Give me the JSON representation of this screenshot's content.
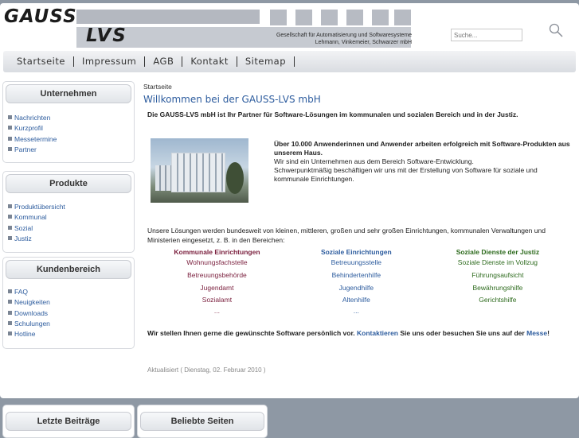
{
  "header": {
    "logo_top": "GAUSS",
    "logo_bottom": "LVS",
    "tagline_1": "Gesellschaft für Automatisierung und Softwaresysteme",
    "tagline_2": "Lehmann, Vinkemeier, Schwarzer mbH",
    "search_placeholder": "Suche..."
  },
  "nav": [
    "Startseite",
    "Impressum",
    "AGB",
    "Kontakt",
    "Sitemap"
  ],
  "sidebar": [
    {
      "title": "Unternehmen",
      "items": [
        "Nachrichten",
        "Kurzprofil",
        "Messetermine",
        "Partner"
      ]
    },
    {
      "title": "Produkte",
      "items": [
        "Produktübersicht",
        "Kommunal",
        "Sozial",
        "Justiz"
      ]
    },
    {
      "title": "Kundenbereich",
      "items": [
        "FAQ",
        "Neuigkeiten",
        "Downloads",
        "Schulungen",
        "Hotline"
      ]
    }
  ],
  "main": {
    "breadcrumb": "Startseite",
    "title": "Willkommen bei der GAUSS-LVS mbH",
    "intro": "Die GAUSS-LVS mbH ist Ihr Partner für Software-Lösungen im kommunalen und sozialen Bereich und in der Justiz.",
    "highlight": "Über 10.000 Anwenderinnen und Anwender arbeiten erfolgreich mit Software-Produkten aus unserem Haus.",
    "body_1": "Wir sind ein Unternehmen aus dem Bereich Software-Entwicklung.",
    "body_2": "Schwerpunktmäßig beschäftigen wir uns mit der Erstellung von Software für soziale und kommunale Einrichtungen.",
    "solutions": "Unsere Lösungen werden bundesweit von kleinen, mittleren, großen und sehr großen Einrichtungen, kommunalen Verwaltungen und Ministerien eingesetzt, z. B. in den Bereichen:",
    "columns": [
      {
        "header": "Kommunale Einrichtungen",
        "items": [
          "Wohnungsfachstelle",
          "Betreuungsbehörde",
          "Jugendamt",
          "Sozialamt",
          "..."
        ]
      },
      {
        "header": "Soziale Einrichtungen",
        "items": [
          "Betreuungsstelle",
          "Behindertenhilfe",
          "Jugendhilfe",
          "Altenhilfe",
          "..."
        ]
      },
      {
        "header": "Soziale Dienste der Justiz",
        "items": [
          "Soziale Dienste im Vollzug",
          "Führungsaufsicht",
          "Bewährungshilfe",
          "Gerichtshilfe"
        ]
      }
    ],
    "closing_1": "Wir stellen Ihnen gerne die gewünschte Software persönlich vor.",
    "closing_link_1": "Kontaktieren",
    "closing_2": "Sie uns oder besuchen Sie uns auf der",
    "closing_link_2": "Messe",
    "closing_3": "!",
    "updated": "Aktualisiert ( Dienstag, 02. Februar 2010 )"
  },
  "bottom_tabs": [
    "Letzte Beiträge",
    "Beliebte Seiten"
  ]
}
